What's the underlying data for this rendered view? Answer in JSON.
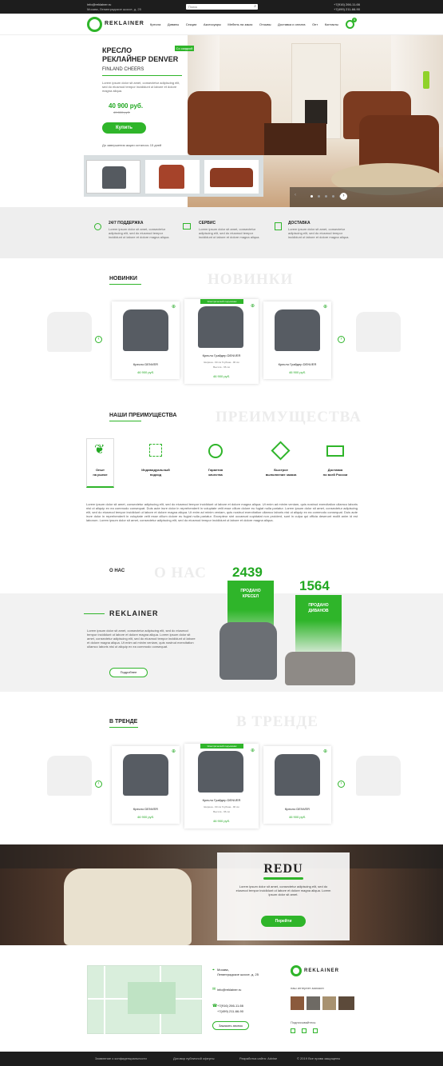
{
  "topbar": {
    "email": "info@reklainer.ru",
    "address": "Москва, Ленинградское шоссе, д. 25",
    "search_placeholder": "Поиск",
    "phone1": "+7(916) 266-11-66",
    "phone2": "+7(499) 211-66-90"
  },
  "nav": {
    "brand": "REKLAINER",
    "items": [
      "Кресла",
      "Диваны",
      "Секции",
      "Аксессуары",
      "Мебель на заказ",
      "Отзывы",
      "Доставка и оплата",
      "Опт",
      "Контакты"
    ],
    "cart_count": "0"
  },
  "hero": {
    "title_line1": "КРЕСЛО",
    "title_line2": "РЕКЛАЙНЕР DENVER",
    "subtitle": "FINLAND CHEERS",
    "badge": "Со скидкой",
    "desc": "Lorem ipsum dolor sit amet, consectetur adipiscing elit, sed do eiusmod tempor incididunt ut labore et dolore magna aliqua.",
    "price": "40 900 руб.",
    "old_price": "49 800 руб.",
    "buy": "Купить",
    "note": "До завершения акции осталось 15 дней",
    "slider_dots": 5
  },
  "features": [
    {
      "title": "24/7 ПОДДЕРЖКА",
      "text": "Lorem ipsum dolor sit amet, consectetur adipiscing elit, sed do eiusmod tempor incididunt ut labore et dolore magna aliqua."
    },
    {
      "title": "СЕРВИС",
      "text": "Lorem ipsum dolor sit amet, consectetur adipiscing elit, sed do eiusmod tempor incididunt ut labore et dolore magna aliqua."
    },
    {
      "title": "ДОСТАВКА",
      "text": "Lorem ipsum dolor sit amet, consectetur adipiscing elit, sed do eiusmod tempor incididunt ut labore et dolore magna aliqua."
    }
  ],
  "news": {
    "title": "НОВИНКИ",
    "watermark": "НОВИНКИ"
  },
  "products": [
    {
      "name": "Кресло DENVER",
      "price": "46 900 руб."
    },
    {
      "name": "Кресло Грайдер DENVER",
      "badge": "Электрический подъёмник",
      "spec1": "Ширина - 90 см Глубина - 96 см",
      "spec2": "Высота - 96 см",
      "price": "46 900 руб."
    },
    {
      "name": "Кресло Грайдер DENVER",
      "price": "46 900 руб."
    }
  ],
  "trend_products": [
    {
      "name": "Кресло DENVER",
      "price": "46 900 руб."
    },
    {
      "name": "Кресло Грайдер DENVER",
      "badge": "Электрический подъёмник",
      "spec1": "Ширина - 90 см Глубина - 96 см",
      "spec2": "Высота - 96 см",
      "price": "46 900 руб."
    },
    {
      "name": "Кресло DENVER",
      "price": "46 900 руб."
    }
  ],
  "advantages": {
    "title": "НАШИ ПРЕИМУЩЕСТВА",
    "watermark": "ПРЕИМУЩЕСТВА",
    "items": [
      {
        "line1": "Опыт",
        "line2": "на рынке"
      },
      {
        "line1": "Индивидуальный",
        "line2": "подход"
      },
      {
        "line1": "Гарантия",
        "line2": "качества"
      },
      {
        "line1": "Быстрое",
        "line2": "выполнение заказа"
      },
      {
        "line1": "Доставка",
        "line2": "по всей России"
      }
    ],
    "paragraph": "Lorem ipsum dolor sit amet, consectetur adipiscing elit, sed do eiusmod tempor incididunt ut labore et dolore magna aliqua. Ut enim ad minim veniam, quis nostrud exercitation ullamco laboris nisi ut aliquip ex ea commodo consequat. Duis aute irure dolor in reprehenderit in voluptate velit esse cillum dolore eu fugiat nulla pariatur. Lorem ipsum dolor sit amet, consectetur adipiscing elit, sed do eiusmod tempor incididunt ut labore et dolore magna aliqua. Ut enim ad minim veniam, quis nostrud exercitation ullamco laboris nisi ut aliquip ex ea commodo consequat. Duis aute irure dolor in reprehenderit in voluptate velit esse cillum dolore eu fugiat nulla pariatur. Excepteur sint occaecat cupidatat non proident, sunt in culpa qui officia deserunt mollit anim id est laborum. Lorem ipsum dolor sit amet, consectetur adipiscing elit, sed do eiusmod tempor incididunt ut labore et dolore magna aliqua."
  },
  "about": {
    "label": "О НАС",
    "watermark": "О НАС",
    "brand": "REKLAINER",
    "text": "Lorem ipsum dolor sit amet, consectetur adipiscing elit, sed do eiusmod tempor incididunt ut labore et dolore magna aliqua. Lorem ipsum dolor sit amet, consectetur adipiscing elit, sed do eiusmod tempor incididunt ut labore et dolore magna aliqua. Ut enim ad minim veniam, quis nostrud exercitation ullamco laboris nisi ut aliquip ex ea commodo consequat.",
    "more": "Подробнее",
    "stat1_num": "2439",
    "stat1_label1": "ПРОДАНО",
    "stat1_label2": "КРЕСЕЛ",
    "stat2_num": "1564",
    "stat2_label1": "ПРОДАНО",
    "stat2_label2": "ДИВАНОВ"
  },
  "trend": {
    "title": "В ТРЕНДЕ",
    "watermark": "В ТРЕНДЕ"
  },
  "redu": {
    "title": "REDU",
    "text": "Lorem ipsum dolor sit amet, consectetur adipiscing elit, sed do eiusmod tempor incididunt ut labore et dolore magna aliqua. Lorem ipsum dolor sit amet.",
    "button": "Перейти"
  },
  "contacts": {
    "city": "Москва,",
    "street": "Ленинградское шоссе, д. 25",
    "email": "info@reklainer.ru",
    "phone1": "+7(916) 266-11-66",
    "phone2": "+7(499) 211-66-90",
    "callback": "Заказать звонок",
    "brand": "REKLAINER",
    "site_label": "наш интернет-магазин",
    "social_label": "Подписывайтесь:"
  },
  "footer": {
    "links": [
      "Заявление о конфиденциальности",
      "Договор публичной оферты",
      "Разработка сайта: Advise"
    ],
    "copyright": "© 2019 Все права защищены"
  },
  "colors": {
    "accent": "#2fb52a",
    "footer_bg": "#1d1d1d",
    "gray_band": "#eeeeee"
  }
}
